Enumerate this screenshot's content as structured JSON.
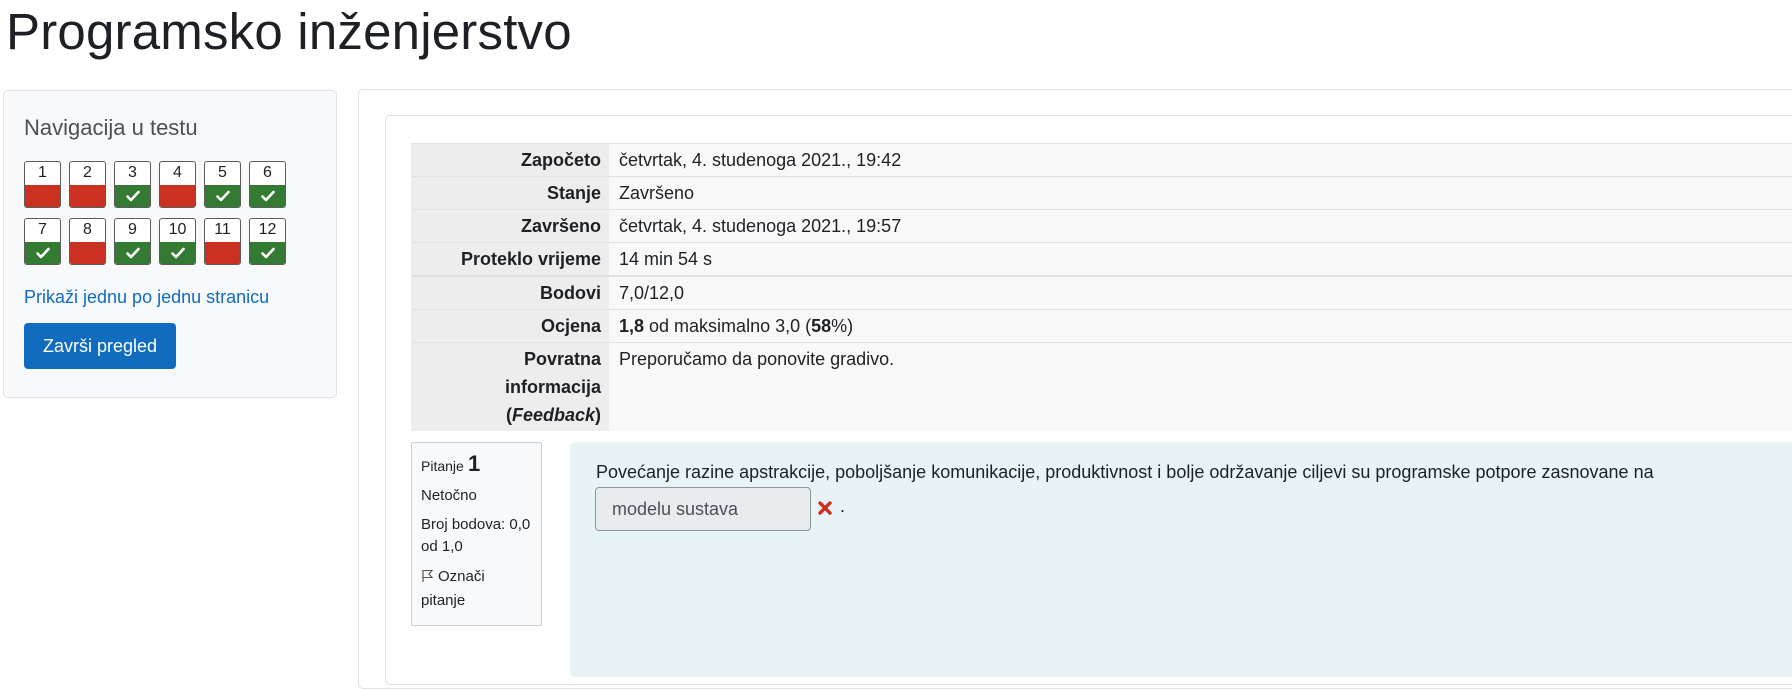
{
  "page_title": "Programsko inženjerstvo",
  "navigation": {
    "title": "Navigacija u testu",
    "questions": [
      {
        "number": "1",
        "state": "incorrect"
      },
      {
        "number": "2",
        "state": "incorrect"
      },
      {
        "number": "3",
        "state": "correct"
      },
      {
        "number": "4",
        "state": "incorrect"
      },
      {
        "number": "5",
        "state": "correct"
      },
      {
        "number": "6",
        "state": "correct"
      },
      {
        "number": "7",
        "state": "correct"
      },
      {
        "number": "8",
        "state": "incorrect"
      },
      {
        "number": "9",
        "state": "correct"
      },
      {
        "number": "10",
        "state": "correct"
      },
      {
        "number": "11",
        "state": "incorrect"
      },
      {
        "number": "12",
        "state": "correct"
      }
    ],
    "show_one_page_link": "Prikaži jednu po jednu stranicu",
    "finish_review_button": "Završi pregled"
  },
  "summary": {
    "started_label": "Započeto",
    "started_value": "četvrtak, 4. studenoga 2021., 19:42",
    "state_label": "Stanje",
    "state_value": "Završeno",
    "completed_label": "Završeno",
    "completed_value": "četvrtak, 4. studenoga 2021., 19:57",
    "time_taken_label": "Proteklo vrijeme",
    "time_taken_value": "14 min 54 s",
    "marks_label": "Bodovi",
    "marks_value": "7,0/12,0",
    "grade_label": "Ocjena",
    "grade_score": "1,8",
    "grade_mid": " od maksimalno 3,0 (",
    "grade_percent": "58",
    "grade_end": "%)",
    "feedback_label_line1": "Povratna",
    "feedback_label_line2": "informacija",
    "feedback_label_open": "(",
    "feedback_label_italic": "Feedback",
    "feedback_label_close": ")",
    "feedback_value": "Preporučamo da ponovite gradivo."
  },
  "question": {
    "label": "Pitanje",
    "number": "1",
    "state": "Netočno",
    "grade_line1": "Broj bodova: 0,0",
    "grade_line2": "od 1,0",
    "flag_line1": "Označi",
    "flag_line2": "pitanje",
    "text": "Povećanje razine apstrakcije, poboljšanje komunikacije, produktivnost i bolje održavanje ciljevi su programske potpore zasnovane na",
    "answer_value": "modelu sustava",
    "trailing": "."
  },
  "colors": {
    "incorrect": "#ca3120",
    "correct": "#357a32",
    "primary": "#0f6cbf"
  }
}
